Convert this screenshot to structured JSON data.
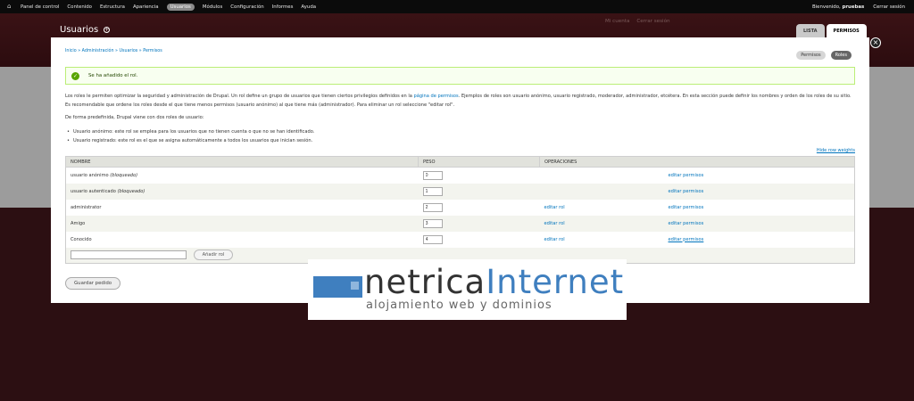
{
  "toolbar": {
    "items": [
      "Panel de control",
      "Contenido",
      "Estructura",
      "Apariencia",
      "Usuarios",
      "Módulos",
      "Configuración",
      "Informes",
      "Ayuda"
    ],
    "welcome_prefix": "Bienvenido,",
    "username": "pruebas",
    "logout": "Cerrar sesión"
  },
  "background_shortcuts": [
    "Mi cuenta",
    "Cerrar sesión"
  ],
  "overlay": {
    "title": "Usuarios",
    "tabs": [
      "LISTA",
      "PERMISOS"
    ],
    "active_tab": "PERMISOS"
  },
  "breadcrumb": "Inicio » Administración » Usuarios » Permisos",
  "secondary_tabs": [
    "Permisos",
    "Roles"
  ],
  "message": "Se ha añadido el rol.",
  "description": {
    "p1_before_link": "Los roles le permiten optimizar la seguridad y administración de Drupal. Un rol define un grupo de usuarios que tienen ciertos privilegios definidos en la ",
    "p1_link": "página de permisos",
    "p1_after_link": ". Ejemplos de roles son usuario anónimo, usuario registrado, moderador, administrador, etcétera. En esta sección puede definir los nombres y orden de los roles de su sitio. Es recomendable que ordene los roles desde el que tiene menos permisos (usuario anónimo) al que tiene más (administrador). Para eliminar un rol seleccione \"editar rol\".",
    "p2": "De forma predefinida, Drupal viene con dos roles de usuario:",
    "bullets": [
      "Usuario anónimo: este rol se emplea para los usuarios que no tienen cuenta o que no se han identificado.",
      "Usuario registrado: este rol es el que se asigna automáticamente a todos los usuarios que inician sesión."
    ]
  },
  "hide_row_weights": "Hide row weights",
  "table": {
    "headers": [
      "NOMBRE",
      "PESO",
      "OPERACIONES"
    ],
    "rows": [
      {
        "name": "usuario anónimo",
        "locked": "(bloqueado)",
        "weight": "0",
        "edit_role": "",
        "edit_perms": "editar permisos"
      },
      {
        "name": "usuario autenticado",
        "locked": "(bloqueado)",
        "weight": "1",
        "edit_role": "",
        "edit_perms": "editar permisos"
      },
      {
        "name": "administrator",
        "locked": "",
        "weight": "2",
        "edit_role": "editar rol",
        "edit_perms": "editar permisos"
      },
      {
        "name": "Amigo",
        "locked": "",
        "weight": "3",
        "edit_role": "editar rol",
        "edit_perms": "editar permisos"
      },
      {
        "name": "Conocido",
        "locked": "",
        "weight": "4",
        "edit_role": "editar rol",
        "edit_perms": "editar permisos"
      }
    ],
    "add_role_button": "Añadir rol",
    "new_role_value": ""
  },
  "save_button": "Guardar pedido",
  "watermark": {
    "word_part1": "netrica",
    "word_part2": "Internet",
    "tagline": "alojamiento web y dominios"
  }
}
